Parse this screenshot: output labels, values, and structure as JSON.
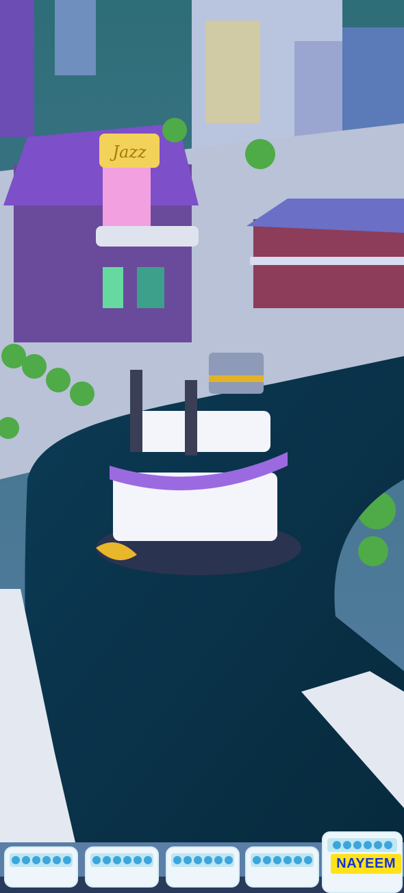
{
  "scene": {
    "building_sign": "Jazz"
  },
  "card_tray": {
    "cards": [
      {
        "slots": 6
      },
      {
        "slots": 6
      },
      {
        "slots": 6
      },
      {
        "slots": 6
      },
      {
        "slots": 6,
        "selected": true
      }
    ]
  },
  "watermark": "NAYEEM",
  "colors": {
    "water": "#0f3850",
    "road": "#d8dfe9",
    "building_purple": "#7a4fc0",
    "boat": "#ffffff"
  }
}
